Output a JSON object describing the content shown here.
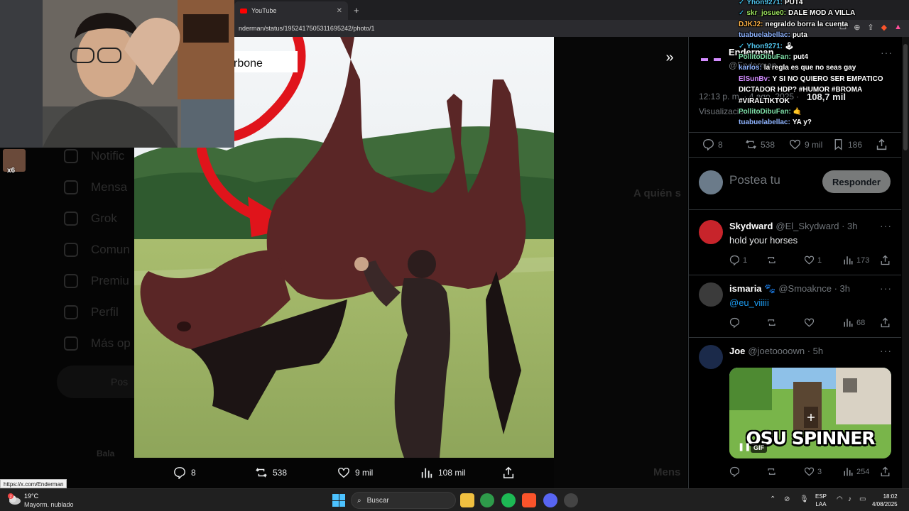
{
  "browser": {
    "tab_title": "YouTube",
    "tab_close": "✕",
    "new_tab": "+",
    "url": "nderman/status/1952417505311695242/photo/1"
  },
  "background": {
    "nav_items": [
      "Notific",
      "Mensa",
      "Grok",
      "Comun",
      "Premiu",
      "Perfil",
      "Más op"
    ],
    "post_label": "Pos",
    "bottom_user": "Bala",
    "dim_right_title": "A quién s",
    "dim_messages": "Mens"
  },
  "photo": {
    "caption_text": "rbone",
    "actions": {
      "replies": "8",
      "reposts": "538",
      "likes": "9 mil",
      "views": "108 mil"
    }
  },
  "post": {
    "author_name": "Enderman",
    "author_handle": "@Enderman",
    "timestamp": "12:13 p. m. · 4 ago. 2025 ·",
    "views_count": "108,7 mil",
    "views_label": "Visualizaciones",
    "stats": {
      "replies": "8",
      "reposts": "538",
      "likes": "9 mil",
      "bookmarks": "186"
    },
    "more": "···"
  },
  "reply_box": {
    "placeholder": "Postea tu",
    "button": "Responder"
  },
  "replies": [
    {
      "name": "Skydward",
      "handle": "@El_Skydward · 3h",
      "text": "hold your horses",
      "replies": "1",
      "likes": "1",
      "views": "173"
    },
    {
      "name": "ismaria 🐾",
      "handle": "@Smoaknce · 3h",
      "text": "@eu_viiiii",
      "replies": "",
      "likes": "",
      "views": "68"
    },
    {
      "name": "Joe",
      "handle": "@joetoooown · 5h",
      "text": "",
      "gif_caption": "OSU SPINNER",
      "gif_badge": "GIF",
      "gif_pause": "❚❚",
      "replies": "",
      "likes": "3",
      "views": "254"
    }
  ],
  "chat": [
    {
      "badge": "✓",
      "user": "Yhon9271:",
      "color": "#4fc1e9",
      "msg": "PUT4"
    },
    {
      "badge": "✓",
      "user": "skr_josue0:",
      "color": "#9be15d",
      "msg": "DALE MOD A VILLA"
    },
    {
      "badge": "",
      "user": "DJKJ2:",
      "color": "#ffb347",
      "msg": "negraldo borra la cuenta"
    },
    {
      "badge": "",
      "user": "tuabuelabellac:",
      "color": "#8fb4ff",
      "msg": "puta"
    },
    {
      "badge": "✓",
      "user": "Yhon9271:",
      "color": "#4fc1e9",
      "msg": "🕹"
    },
    {
      "badge": "",
      "user": "PollitoDibuFan:",
      "color": "#7ee0a8",
      "msg": "put4"
    },
    {
      "badge": "",
      "user": "karlos:",
      "color": "#8fb4ff",
      "msg": "la regla es que no seas gay"
    },
    {
      "badge": "",
      "user": "ElSunBv:",
      "color": "#d28cff",
      "msg": "Y SI NO QUIERO SER EMPATICO"
    },
    {
      "badge": "",
      "user": "",
      "color": "#fff",
      "msg": "DICTADOR HDP? #HUMOR #BROMA"
    },
    {
      "badge": "",
      "user": "",
      "color": "#fff",
      "msg": "#VIRALTIKTOK"
    },
    {
      "badge": "",
      "user": "PollitoDibuFan:",
      "color": "#7ee0a8",
      "msg": "🤙"
    },
    {
      "badge": "",
      "user": "tuabuelabellac:",
      "color": "#8fb4ff",
      "msg": "YA y?"
    }
  ],
  "overlay": {
    "side_emote_text": "x6"
  },
  "status_url": "https://x.com/Enderman",
  "taskbar": {
    "weather_temp": "19°C",
    "weather_desc": "Mayorm. nublado",
    "weather_badge": "2",
    "search_placeholder": "Buscar",
    "lang_line1": "ESP",
    "lang_line2": "LAA",
    "time": "18:02",
    "date": "4/08/2025"
  },
  "colors": {
    "accent": "#1d9bf0",
    "reply_button": "#787a7a",
    "background": "#000000"
  }
}
